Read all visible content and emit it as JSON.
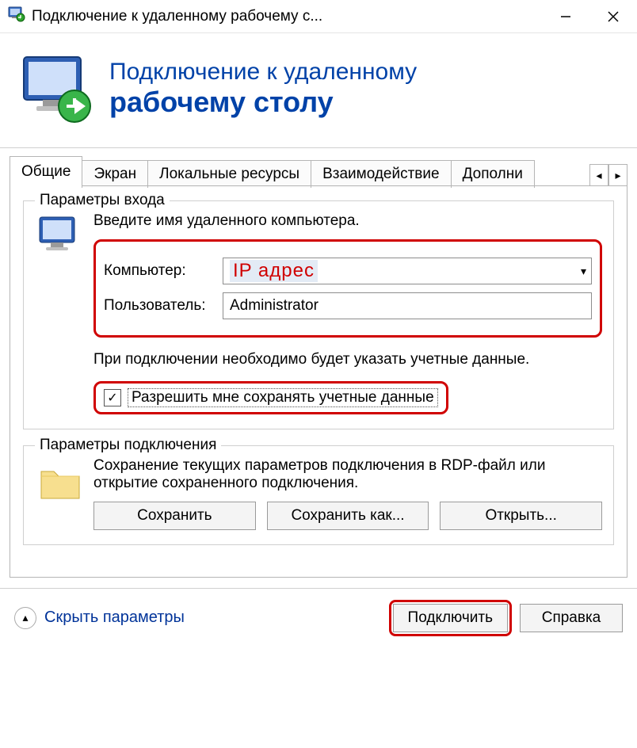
{
  "window": {
    "title": "Подключение к удаленному рабочему с..."
  },
  "banner": {
    "line1": "Подключение к удаленному",
    "line2": "рабочему столу"
  },
  "tabs": {
    "items": [
      "Общие",
      "Экран",
      "Локальные ресурсы",
      "Взаимодействие",
      "Дополни"
    ]
  },
  "login_group": {
    "legend": "Параметры входа",
    "instruction": "Введите имя удаленного компьютера.",
    "computer_label": "Компьютер:",
    "computer_value": "IP адрес",
    "user_label": "Пользователь:",
    "user_value": "Administrator",
    "cred_note": "При подключении необходимо будет указать учетные данные.",
    "save_creds_label": "Разрешить мне сохранять учетные данные",
    "save_creds_checked": true
  },
  "conn_group": {
    "legend": "Параметры подключения",
    "desc": "Сохранение текущих параметров подключения в RDP-файл или открытие сохраненного подключения.",
    "save": "Сохранить",
    "save_as": "Сохранить как...",
    "open": "Открыть..."
  },
  "footer": {
    "hide_params": "Скрыть параметры",
    "connect": "Подключить",
    "help": "Справка"
  }
}
